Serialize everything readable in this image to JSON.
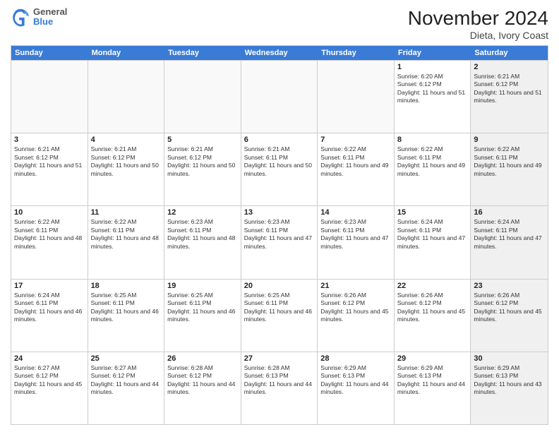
{
  "header": {
    "logo_line1": "General",
    "logo_line2": "Blue",
    "title": "November 2024",
    "subtitle": "Dieta, Ivory Coast"
  },
  "days_of_week": [
    "Sunday",
    "Monday",
    "Tuesday",
    "Wednesday",
    "Thursday",
    "Friday",
    "Saturday"
  ],
  "rows": [
    [
      {
        "day": "",
        "text": "",
        "empty": true
      },
      {
        "day": "",
        "text": "",
        "empty": true
      },
      {
        "day": "",
        "text": "",
        "empty": true
      },
      {
        "day": "",
        "text": "",
        "empty": true
      },
      {
        "day": "",
        "text": "",
        "empty": true
      },
      {
        "day": "1",
        "text": "Sunrise: 6:20 AM\nSunset: 6:12 PM\nDaylight: 11 hours and 51 minutes.",
        "empty": false,
        "shaded": false
      },
      {
        "day": "2",
        "text": "Sunrise: 6:21 AM\nSunset: 6:12 PM\nDaylight: 11 hours and 51 minutes.",
        "empty": false,
        "shaded": true
      }
    ],
    [
      {
        "day": "3",
        "text": "Sunrise: 6:21 AM\nSunset: 6:12 PM\nDaylight: 11 hours and 51 minutes.",
        "empty": false,
        "shaded": false
      },
      {
        "day": "4",
        "text": "Sunrise: 6:21 AM\nSunset: 6:12 PM\nDaylight: 11 hours and 50 minutes.",
        "empty": false,
        "shaded": false
      },
      {
        "day": "5",
        "text": "Sunrise: 6:21 AM\nSunset: 6:12 PM\nDaylight: 11 hours and 50 minutes.",
        "empty": false,
        "shaded": false
      },
      {
        "day": "6",
        "text": "Sunrise: 6:21 AM\nSunset: 6:11 PM\nDaylight: 11 hours and 50 minutes.",
        "empty": false,
        "shaded": false
      },
      {
        "day": "7",
        "text": "Sunrise: 6:22 AM\nSunset: 6:11 PM\nDaylight: 11 hours and 49 minutes.",
        "empty": false,
        "shaded": false
      },
      {
        "day": "8",
        "text": "Sunrise: 6:22 AM\nSunset: 6:11 PM\nDaylight: 11 hours and 49 minutes.",
        "empty": false,
        "shaded": false
      },
      {
        "day": "9",
        "text": "Sunrise: 6:22 AM\nSunset: 6:11 PM\nDaylight: 11 hours and 49 minutes.",
        "empty": false,
        "shaded": true
      }
    ],
    [
      {
        "day": "10",
        "text": "Sunrise: 6:22 AM\nSunset: 6:11 PM\nDaylight: 11 hours and 48 minutes.",
        "empty": false,
        "shaded": false
      },
      {
        "day": "11",
        "text": "Sunrise: 6:22 AM\nSunset: 6:11 PM\nDaylight: 11 hours and 48 minutes.",
        "empty": false,
        "shaded": false
      },
      {
        "day": "12",
        "text": "Sunrise: 6:23 AM\nSunset: 6:11 PM\nDaylight: 11 hours and 48 minutes.",
        "empty": false,
        "shaded": false
      },
      {
        "day": "13",
        "text": "Sunrise: 6:23 AM\nSunset: 6:11 PM\nDaylight: 11 hours and 47 minutes.",
        "empty": false,
        "shaded": false
      },
      {
        "day": "14",
        "text": "Sunrise: 6:23 AM\nSunset: 6:11 PM\nDaylight: 11 hours and 47 minutes.",
        "empty": false,
        "shaded": false
      },
      {
        "day": "15",
        "text": "Sunrise: 6:24 AM\nSunset: 6:11 PM\nDaylight: 11 hours and 47 minutes.",
        "empty": false,
        "shaded": false
      },
      {
        "day": "16",
        "text": "Sunrise: 6:24 AM\nSunset: 6:11 PM\nDaylight: 11 hours and 47 minutes.",
        "empty": false,
        "shaded": true
      }
    ],
    [
      {
        "day": "17",
        "text": "Sunrise: 6:24 AM\nSunset: 6:11 PM\nDaylight: 11 hours and 46 minutes.",
        "empty": false,
        "shaded": false
      },
      {
        "day": "18",
        "text": "Sunrise: 6:25 AM\nSunset: 6:11 PM\nDaylight: 11 hours and 46 minutes.",
        "empty": false,
        "shaded": false
      },
      {
        "day": "19",
        "text": "Sunrise: 6:25 AM\nSunset: 6:11 PM\nDaylight: 11 hours and 46 minutes.",
        "empty": false,
        "shaded": false
      },
      {
        "day": "20",
        "text": "Sunrise: 6:25 AM\nSunset: 6:11 PM\nDaylight: 11 hours and 46 minutes.",
        "empty": false,
        "shaded": false
      },
      {
        "day": "21",
        "text": "Sunrise: 6:26 AM\nSunset: 6:12 PM\nDaylight: 11 hours and 45 minutes.",
        "empty": false,
        "shaded": false
      },
      {
        "day": "22",
        "text": "Sunrise: 6:26 AM\nSunset: 6:12 PM\nDaylight: 11 hours and 45 minutes.",
        "empty": false,
        "shaded": false
      },
      {
        "day": "23",
        "text": "Sunrise: 6:26 AM\nSunset: 6:12 PM\nDaylight: 11 hours and 45 minutes.",
        "empty": false,
        "shaded": true
      }
    ],
    [
      {
        "day": "24",
        "text": "Sunrise: 6:27 AM\nSunset: 6:12 PM\nDaylight: 11 hours and 45 minutes.",
        "empty": false,
        "shaded": false
      },
      {
        "day": "25",
        "text": "Sunrise: 6:27 AM\nSunset: 6:12 PM\nDaylight: 11 hours and 44 minutes.",
        "empty": false,
        "shaded": false
      },
      {
        "day": "26",
        "text": "Sunrise: 6:28 AM\nSunset: 6:12 PM\nDaylight: 11 hours and 44 minutes.",
        "empty": false,
        "shaded": false
      },
      {
        "day": "27",
        "text": "Sunrise: 6:28 AM\nSunset: 6:13 PM\nDaylight: 11 hours and 44 minutes.",
        "empty": false,
        "shaded": false
      },
      {
        "day": "28",
        "text": "Sunrise: 6:29 AM\nSunset: 6:13 PM\nDaylight: 11 hours and 44 minutes.",
        "empty": false,
        "shaded": false
      },
      {
        "day": "29",
        "text": "Sunrise: 6:29 AM\nSunset: 6:13 PM\nDaylight: 11 hours and 44 minutes.",
        "empty": false,
        "shaded": false
      },
      {
        "day": "30",
        "text": "Sunrise: 6:29 AM\nSunset: 6:13 PM\nDaylight: 11 hours and 43 minutes.",
        "empty": false,
        "shaded": true
      }
    ]
  ]
}
